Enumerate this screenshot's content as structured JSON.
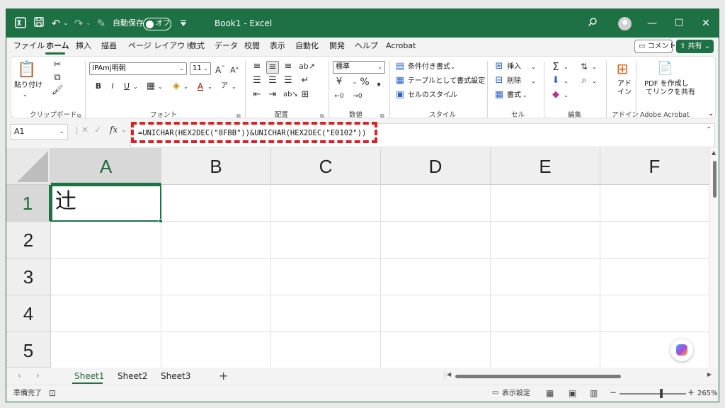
{
  "titlebar": {
    "autosave_label": "自動保存",
    "autosave_state": "オフ",
    "title": "Book1  -  Excel",
    "icons": [
      "excel-logo-icon",
      "save-icon",
      "undo-icon",
      "redo-icon",
      "paintbrush-icon",
      "customize-icon",
      "search-icon",
      "user-avatar",
      "minimize-icon",
      "maximize-icon",
      "close-icon"
    ]
  },
  "tabs": [
    "ファイル",
    "ホーム",
    "挿入",
    "描画",
    "ページ レイアウト",
    "数式",
    "データ",
    "校閲",
    "表示",
    "自動化",
    "開発",
    "ヘルプ",
    "Acrobat"
  ],
  "active_tab": "ホーム",
  "comment_button": "コメント",
  "share_button": "共有",
  "ribbon": {
    "clipboard": {
      "paste": "貼り付け",
      "group": "クリップボード"
    },
    "font": {
      "name": "IPAmj明朝",
      "size": "11",
      "group": "フォント"
    },
    "alignment": {
      "group": "配置"
    },
    "number": {
      "format": "標準",
      "group": "数値"
    },
    "styles": {
      "conditional": "条件付き書式",
      "table": "テーブルとして書式設定",
      "cell_styles": "セルのスタイル",
      "group": "スタイル"
    },
    "cells": {
      "insert": "挿入",
      "delete": "削除",
      "format": "書式",
      "group": "セル"
    },
    "editing": {
      "group": "編集"
    },
    "addins": {
      "label1": "アド",
      "label2": "イン",
      "group": "アドイン"
    },
    "acrobat": {
      "label1": "PDF を作成し",
      "label2": "てリンクを共有",
      "group": "Adobe Acrobat"
    }
  },
  "formula_bar": {
    "name_box": "A1",
    "fx": "fx",
    "formula": "=UNICHAR(HEX2DEC(\"8FBB\"))&UNICHAR(HEX2DEC(\"E0102\"))",
    "highlight_color": "#e02020"
  },
  "grid": {
    "columns": [
      "A",
      "B",
      "C",
      "D",
      "E",
      "F"
    ],
    "rows": [
      "1",
      "2",
      "3",
      "4",
      "5"
    ],
    "active_cell": "A1",
    "a1_value": "辻"
  },
  "sheets": [
    "Sheet1",
    "Sheet2",
    "Sheet3"
  ],
  "active_sheet": "Sheet1",
  "status": {
    "ready": "準備完了",
    "display_settings": "表示設定",
    "zoom": "265%"
  },
  "colors": {
    "brand": "#1e7145",
    "highlight": "#e02020"
  }
}
